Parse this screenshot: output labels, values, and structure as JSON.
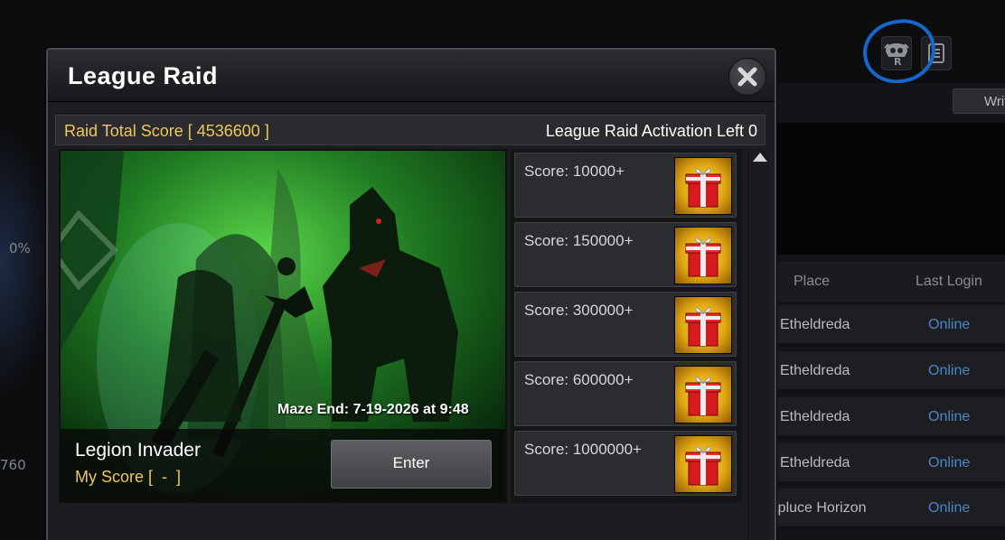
{
  "background": {
    "percent_text": "0%",
    "count_text": "760",
    "write_button_label": "Write",
    "icons": [
      "league-raid-icon",
      "notes-icon"
    ],
    "table": {
      "headers": [
        "Place",
        "Last Login"
      ],
      "rows": [
        {
          "place": "Etheldreda",
          "status": "Online"
        },
        {
          "place": "Etheldreda",
          "status": "Online"
        },
        {
          "place": "Etheldreda",
          "status": "Online"
        },
        {
          "place": "Etheldreda",
          "status": "Online"
        },
        {
          "place": "Apluce Horizon",
          "status": "Online"
        }
      ]
    }
  },
  "modal": {
    "title": "League Raid",
    "raid_total_score": "Raid Total Score [ 4536600 ]",
    "activation_left": "League Raid Activation Left 0",
    "raid": {
      "name": "Legion Invader",
      "my_score": "My Score [  -  ]",
      "maze_end": "Maze End: 7-19-2026 at 9:48",
      "enter_label": "Enter"
    },
    "rewards": [
      {
        "label": "Score: 10000+",
        "icon": "gift-box-icon"
      },
      {
        "label": "Score: 150000+",
        "icon": "gift-box-icon"
      },
      {
        "label": "Score: 300000+",
        "icon": "gift-box-icon"
      },
      {
        "label": "Score: 600000+",
        "icon": "gift-box-icon"
      },
      {
        "label": "Score: 1000000+",
        "icon": "gift-box-icon"
      }
    ]
  },
  "colors": {
    "gold_text": "#f1c75a",
    "online_blue": "#4a86c8",
    "annotation_circle": "#1666cc"
  }
}
